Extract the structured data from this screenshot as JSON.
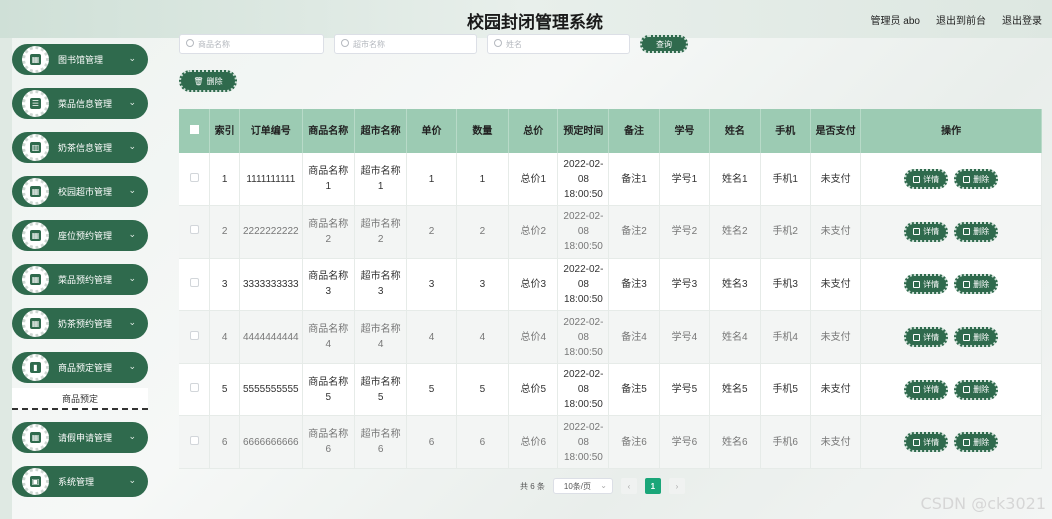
{
  "header": {
    "title": "校园封闭管理系统",
    "user_label": "管理员 abo",
    "back_label": "退出到前台",
    "logout_label": "退出登录"
  },
  "sidebar": {
    "items": [
      {
        "label": "图书馆管理",
        "icon": "grid-icon"
      },
      {
        "label": "菜品信息管理",
        "icon": "list-icon"
      },
      {
        "label": "奶茶信息管理",
        "icon": "books-icon"
      },
      {
        "label": "校园超市管理",
        "icon": "grid-icon"
      },
      {
        "label": "座位预约管理",
        "icon": "grid-icon"
      },
      {
        "label": "菜品预约管理",
        "icon": "grid-icon"
      },
      {
        "label": "奶茶预约管理",
        "icon": "grid-icon"
      },
      {
        "label": "商品预定管理",
        "icon": "chart-icon"
      },
      {
        "label": "请假申请管理",
        "icon": "grid-icon"
      },
      {
        "label": "系统管理",
        "icon": "briefcase-icon"
      }
    ],
    "submenu_label": "商品预定"
  },
  "search": {
    "product_placeholder": "商品名称",
    "market_placeholder": "超市名称",
    "name_placeholder": "姓名",
    "query_label": "查询"
  },
  "toolbar": {
    "delete_label": "删除"
  },
  "table": {
    "headers": [
      "",
      "索引",
      "订单编号",
      "商品名称",
      "超市名称",
      "单价",
      "数量",
      "总价",
      "预定时间",
      "备注",
      "学号",
      "姓名",
      "手机",
      "是否支付",
      "操作"
    ],
    "rows": [
      {
        "index": "1",
        "order": "1111111111",
        "product": "商品名称1",
        "market": "超市名称1",
        "price": "1",
        "qty": "1",
        "total": "总价1",
        "time": "2022-02-08 18:00:50",
        "note": "备注1",
        "sid": "学号1",
        "name": "姓名1",
        "phone": "手机1",
        "paid": "未支付"
      },
      {
        "index": "2",
        "order": "2222222222",
        "product": "商品名称2",
        "market": "超市名称2",
        "price": "2",
        "qty": "2",
        "total": "总价2",
        "time": "2022-02-08 18:00:50",
        "note": "备注2",
        "sid": "学号2",
        "name": "姓名2",
        "phone": "手机2",
        "paid": "未支付"
      },
      {
        "index": "3",
        "order": "3333333333",
        "product": "商品名称3",
        "market": "超市名称3",
        "price": "3",
        "qty": "3",
        "total": "总价3",
        "time": "2022-02-08 18:00:50",
        "note": "备注3",
        "sid": "学号3",
        "name": "姓名3",
        "phone": "手机3",
        "paid": "未支付"
      },
      {
        "index": "4",
        "order": "4444444444",
        "product": "商品名称4",
        "market": "超市名称4",
        "price": "4",
        "qty": "4",
        "total": "总价4",
        "time": "2022-02-08 18:00:50",
        "note": "备注4",
        "sid": "学号4",
        "name": "姓名4",
        "phone": "手机4",
        "paid": "未支付"
      },
      {
        "index": "5",
        "order": "5555555555",
        "product": "商品名称5",
        "market": "超市名称5",
        "price": "5",
        "qty": "5",
        "total": "总价5",
        "time": "2022-02-08 18:00:50",
        "note": "备注5",
        "sid": "学号5",
        "name": "姓名5",
        "phone": "手机5",
        "paid": "未支付"
      },
      {
        "index": "6",
        "order": "6666666666",
        "product": "商品名称6",
        "market": "超市名称6",
        "price": "6",
        "qty": "6",
        "total": "总价6",
        "time": "2022-02-08 18:00:50",
        "note": "备注6",
        "sid": "学号6",
        "name": "姓名6",
        "phone": "手机6",
        "paid": "未支付"
      }
    ],
    "detail_label": "详情",
    "delete_label": "删除"
  },
  "pager": {
    "total_label": "共 6 条",
    "page_size_label": "10条/页",
    "current_page": "1",
    "prev": "‹",
    "next": "›"
  },
  "watermark": "CSDN @ck3021",
  "colors": {
    "primary": "#2f6a4d",
    "header_bg": "#9ccbb3",
    "active_page": "#1aa679"
  }
}
